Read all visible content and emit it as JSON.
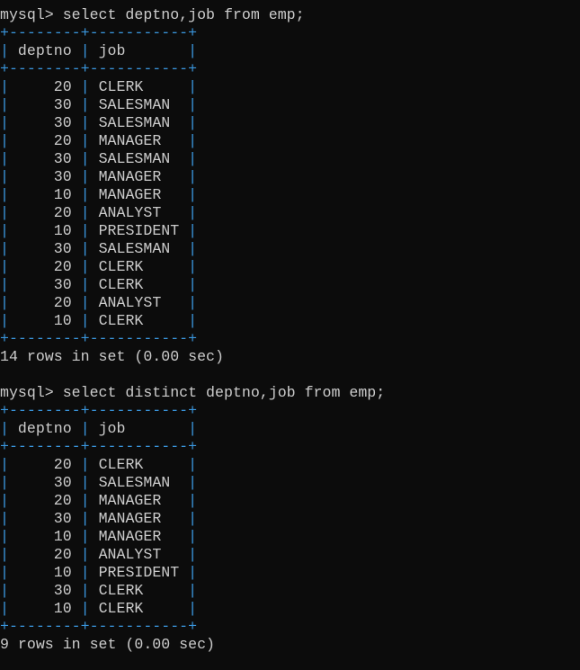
{
  "colors": {
    "background": "#0c0c0c",
    "text": "#cccccc",
    "table_border": "#3a96dd"
  },
  "queries": [
    {
      "prompt": "mysql>",
      "command": "select deptno,job from emp;",
      "columns": [
        "deptno",
        "job"
      ],
      "rows": [
        [
          "20",
          "CLERK"
        ],
        [
          "30",
          "SALESMAN"
        ],
        [
          "30",
          "SALESMAN"
        ],
        [
          "20",
          "MANAGER"
        ],
        [
          "30",
          "SALESMAN"
        ],
        [
          "30",
          "MANAGER"
        ],
        [
          "10",
          "MANAGER"
        ],
        [
          "20",
          "ANALYST"
        ],
        [
          "10",
          "PRESIDENT"
        ],
        [
          "30",
          "SALESMAN"
        ],
        [
          "20",
          "CLERK"
        ],
        [
          "30",
          "CLERK"
        ],
        [
          "20",
          "ANALYST"
        ],
        [
          "10",
          "CLERK"
        ]
      ],
      "status": "14 rows in set (0.00 sec)"
    },
    {
      "prompt": "mysql>",
      "command": "select distinct deptno,job from emp;",
      "columns": [
        "deptno",
        "job"
      ],
      "rows": [
        [
          "20",
          "CLERK"
        ],
        [
          "30",
          "SALESMAN"
        ],
        [
          "20",
          "MANAGER"
        ],
        [
          "30",
          "MANAGER"
        ],
        [
          "10",
          "MANAGER"
        ],
        [
          "20",
          "ANALYST"
        ],
        [
          "10",
          "PRESIDENT"
        ],
        [
          "30",
          "CLERK"
        ],
        [
          "10",
          "CLERK"
        ]
      ],
      "status": "9 rows in set (0.00 sec)"
    }
  ]
}
